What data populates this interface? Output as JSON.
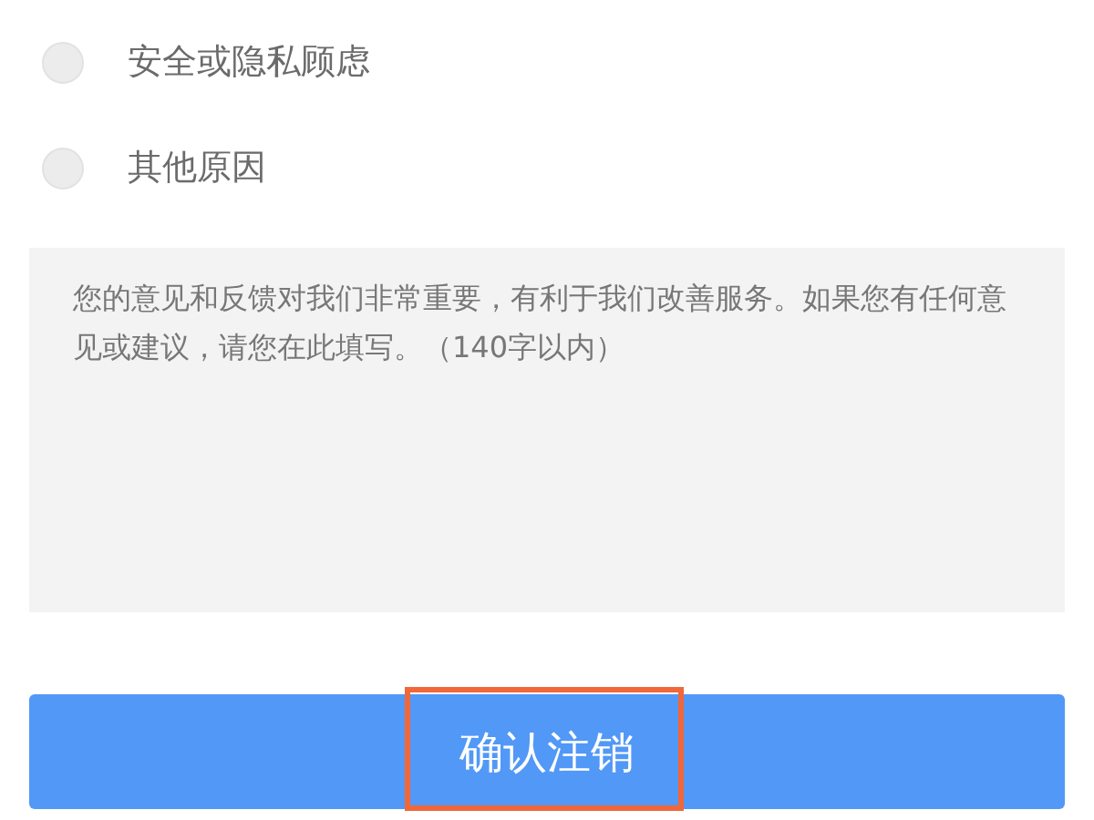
{
  "reasons": [
    {
      "label": "安全或隐私顾虑",
      "selected": false
    },
    {
      "label": "其他原因",
      "selected": false
    }
  ],
  "feedback": {
    "placeholder": "您的意见和反馈对我们非常重要，有利于我们改善服务。如果您有任何意见或建议，请您在此填写。（140字以内）"
  },
  "submit_button": {
    "label": "确认注销",
    "highlighted": true
  }
}
